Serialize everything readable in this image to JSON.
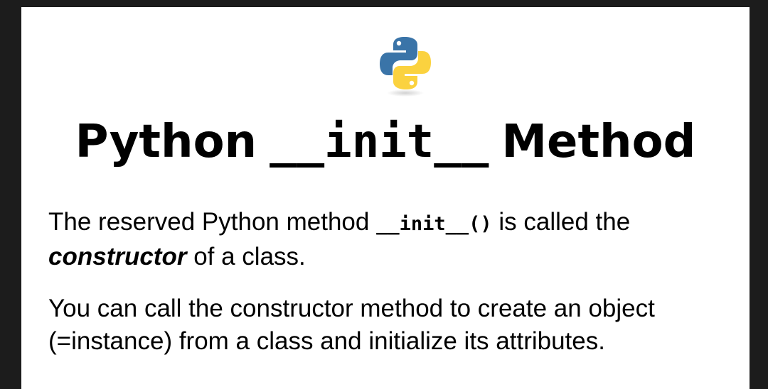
{
  "title": {
    "word1": "Python",
    "code": "__init__",
    "word2": "Method"
  },
  "paragraph1": {
    "text_before": "The reserved Python method ",
    "code": "__init__()",
    "text_after": " is called the ",
    "emphasis": "constructor",
    "text_end": " of a class."
  },
  "paragraph2": {
    "text": "You can call the constructor method to create an object (=instance) from a class and initialize its attributes."
  },
  "colors": {
    "python_blue": "#3a74a8",
    "python_yellow": "#fbd23f",
    "background": "#ffffff",
    "frame": "#1c1c1c"
  },
  "icons": {
    "logo": "python-logo-icon"
  }
}
